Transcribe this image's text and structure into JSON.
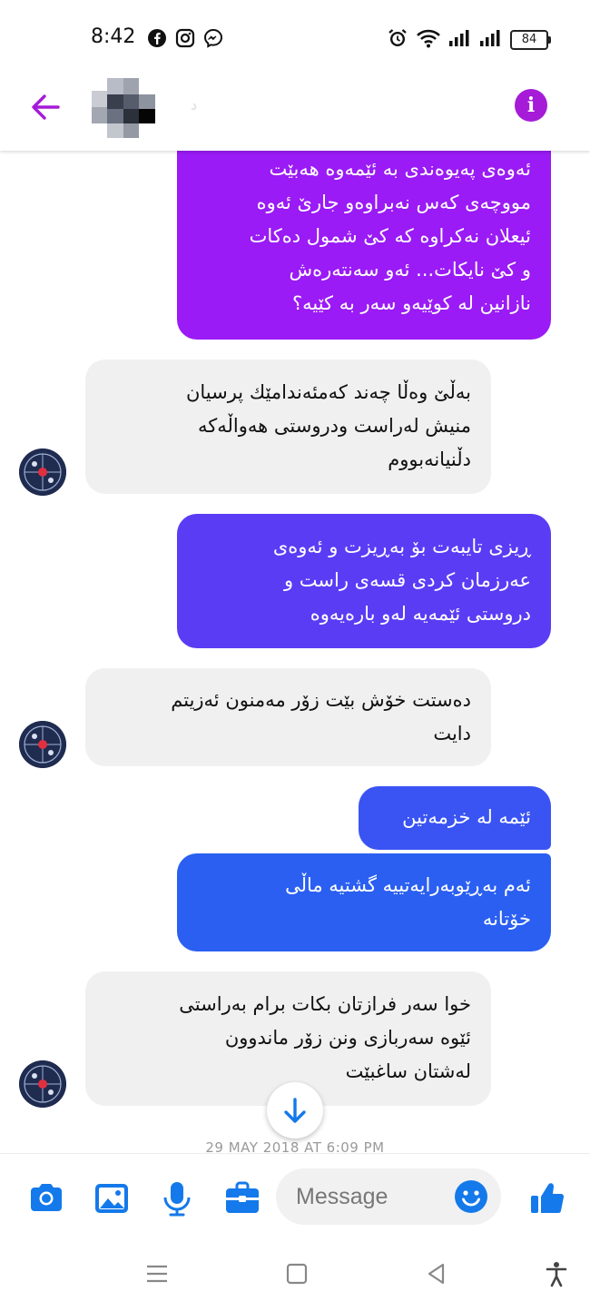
{
  "status_bar": {
    "time": "8:42",
    "battery": "84",
    "app_icons": [
      "facebook-icon",
      "instagram-icon",
      "messenger-icon"
    ],
    "right_icons": [
      "alarm-icon",
      "wifi-icon",
      "signal-icon",
      "signal-icon",
      "battery-icon"
    ]
  },
  "header": {
    "contact_name": "د",
    "back_icon": "arrow-left-icon",
    "info_icon": "info-icon",
    "info_label": "i"
  },
  "messages": [
    {
      "sender": "me",
      "lines": [
        "ئەوەی پەیوەندی بە ئێمەوە هەبێت",
        "مووچەی کەس نەبراوەو جارێ ئەوە",
        "ئیعلان نەکراوە کە کێ شمول دەکات",
        "و کێ نایکات... ئەو سەنتەرەش",
        "نازانین لە کوێیەو سەر بە کێیە؟"
      ]
    },
    {
      "sender": "contact",
      "lines": [
        "بەڵێ وەڵا چەند کەمئەندامێك پرسیان",
        "منیش لەراست ودروستی هەواڵەکە",
        "دڵنیانەبووم"
      ]
    },
    {
      "sender": "me",
      "lines": [
        "ڕیزی تایبەت بۆ بەڕیزت و ئەوەی",
        "عەرزمان کردی قسەی راست و",
        "دروستی ئێمەیە لەو بارەیەوە"
      ]
    },
    {
      "sender": "contact",
      "lines": [
        "دەستت خۆش بێت زۆر مەمنون ئەزیتم",
        "دایت"
      ]
    },
    {
      "sender": "me",
      "lines": [
        "ئێمە لە خزمەتین"
      ]
    },
    {
      "sender": "me",
      "lines": [
        "ئەم بەڕێوبەرایەتییە گشتیە ماڵی",
        "خۆتانە"
      ]
    },
    {
      "sender": "contact",
      "lines": [
        "خوا سەر فرازتان بکات برام بەراستی",
        "ئێوە سەربازی ونن زۆر ماندوون",
        "لەشتان ساغبێت"
      ]
    }
  ],
  "date_separator": "29 MAY 2018 AT 6:09 PM",
  "composer": {
    "placeholder": "Message",
    "icons": [
      "camera-icon",
      "gallery-icon",
      "microphone-icon",
      "briefcase-icon",
      "emoji-icon",
      "thumbs-up-icon"
    ]
  },
  "navbar": {
    "icons": [
      "menu-icon",
      "home-square-icon",
      "back-triangle-icon",
      "accessibility-icon"
    ]
  },
  "colors": {
    "accent": "#a51bd8",
    "sent_top": "#9a1bf5",
    "sent_mid": "#5b3cf5",
    "sent_bottom": "#2a5ff2",
    "received": "#f0f0f0",
    "link_blue": "#1479ea"
  }
}
